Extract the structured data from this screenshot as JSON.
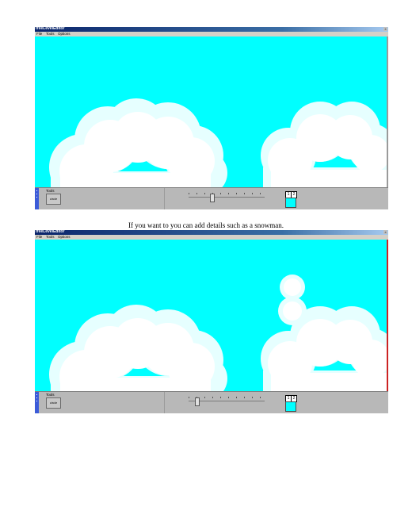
{
  "screenshot1": {
    "window_title": "treeLevelEditor",
    "menu": [
      "File",
      "Tools",
      "Options"
    ],
    "tools_label": "Tools",
    "circle_button_label": "circle",
    "layer_tabs": [
      "1",
      "2"
    ],
    "slider_value": 0.3
  },
  "caption": "If you want to you can add details such as a snowman.",
  "screenshot2": {
    "window_title": "treeLevelEditor",
    "menu": [
      "File",
      "Tools",
      "Options"
    ],
    "tools_label": "Tools",
    "circle_button_label": "circle",
    "layer_tabs": [
      "1",
      "2"
    ],
    "slider_value": 0.1
  },
  "colors": {
    "sky": "#00ffff",
    "snow_light": "#e6ffff",
    "snow_white": "#ffffff",
    "panel": "#b8b8b8",
    "titlebar": "#0a246a"
  }
}
